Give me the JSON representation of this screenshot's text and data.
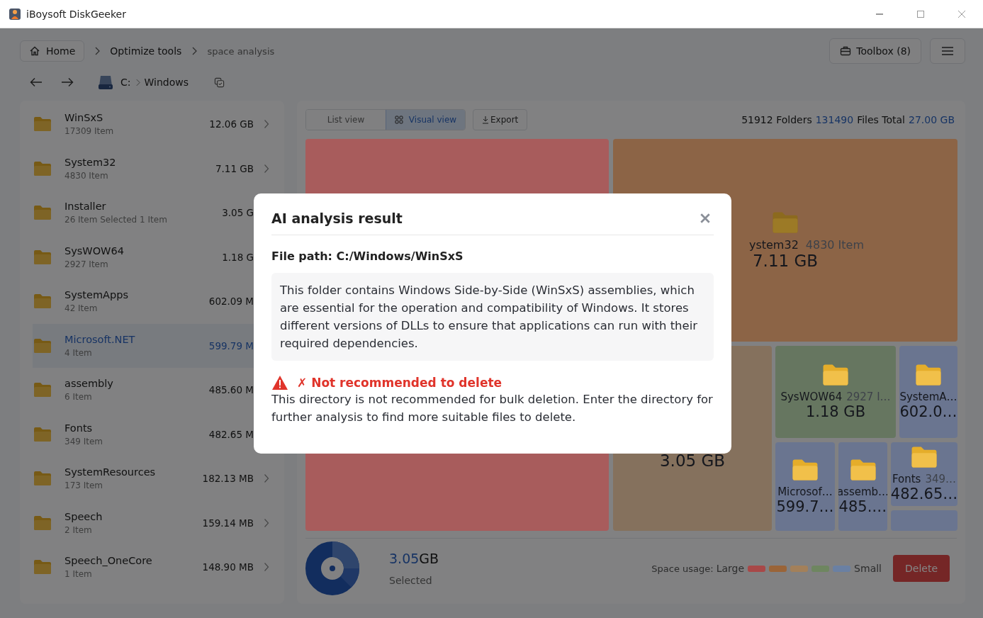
{
  "window": {
    "title": "iBoysoft DiskGeeker"
  },
  "breadcrumb": {
    "home": "Home",
    "items": [
      {
        "label": "Optimize tools",
        "current": false
      },
      {
        "label": "space analysis",
        "current": true
      }
    ]
  },
  "toolbox": {
    "label": "Toolbox",
    "count": "(8)"
  },
  "path": {
    "drive": "C:",
    "folder": "Windows"
  },
  "sidebar": {
    "items": [
      {
        "name": "WinSxS",
        "count": "17309 Item",
        "size": "12.06 GB",
        "selected": false,
        "chevron": true
      },
      {
        "name": "System32",
        "count": "4830 Item",
        "size": "7.11 GB",
        "selected": false,
        "chevron": true
      },
      {
        "name": "Installer",
        "count": "26 Item Selected 1 Item",
        "size": "3.05 G",
        "selected": false
      },
      {
        "name": "SysWOW64",
        "count": "2927 Item",
        "size": "1.18 G",
        "selected": false
      },
      {
        "name": "SystemApps",
        "count": "42 Item",
        "size": "602.09 M",
        "selected": false
      },
      {
        "name": "Microsoft.NET",
        "count": "4 Item",
        "size": "599.79 M",
        "selected": true
      },
      {
        "name": "assembly",
        "count": "6 Item",
        "size": "485.60 M",
        "selected": false
      },
      {
        "name": "Fonts",
        "count": "349 Item",
        "size": "482.65 M",
        "selected": false
      },
      {
        "name": "SystemResources",
        "count": "173 Item",
        "size": "182.13 MB",
        "selected": false,
        "chevron": true
      },
      {
        "name": "Speech",
        "count": "2 Item",
        "size": "159.14 MB",
        "selected": false,
        "chevron": true
      },
      {
        "name": "Speech_OneCore",
        "count": "1 Item",
        "size": "148.90 MB",
        "selected": false,
        "chevron": true
      }
    ]
  },
  "view_tabs": [
    {
      "label": "List view",
      "selected": false
    },
    {
      "label": "Visual view",
      "selected": true
    }
  ],
  "export": "Export",
  "stats": {
    "folders": "51912",
    "folders_label": "Folders",
    "files": "131490",
    "files_label": "Files Total",
    "total": "27.00 GB"
  },
  "tiles": [
    {
      "color": "#a85c5c"
    },
    {
      "color": "#8c6446"
    },
    {
      "color": "#85715d",
      "size": "3.05 GB"
    },
    {
      "color": "#667660",
      "name": "SysWOW64",
      "count": "2927 I…",
      "size": "1.18 GB"
    },
    {
      "color": "#6a7590",
      "name": "SystemA…",
      "size": "602.0…"
    },
    {
      "color": "#6a7590",
      "name": "Microsof…",
      "size": "599.7…"
    },
    {
      "color": "#6a7590",
      "name": "assemb…",
      "size": "485.…"
    },
    {
      "color": "#6a7590",
      "name": "Fonts",
      "count": "349…",
      "size": "482.65…"
    },
    {
      "color": "#6a7590"
    }
  ],
  "tile_label": {
    "name": "ystem32",
    "count": "4830 Item",
    "size": "7.11 GB"
  },
  "selection": {
    "value": "3.05",
    "unit": "GB",
    "label": "Selected"
  },
  "legend": {
    "label": "Space usage:",
    "large": "Large",
    "small": "Small",
    "swatches": [
      {
        "color": "#a84848"
      },
      {
        "color": "#9a6438"
      },
      {
        "color": "#a3805a"
      },
      {
        "color": "#6e8660"
      },
      {
        "color": "#6a80a3"
      }
    ]
  },
  "delete": "Delete",
  "dialog": {
    "title": "AI analysis result",
    "path": "File path: C:/Windows/WinSxS",
    "description": "This folder contains Windows Side-by-Side (WinSxS) assemblies, which are essential for the operation and compatibility of Windows. It stores different versions of DLLs to ensure that applications can run with their required dependencies.",
    "verdict": "✗ Not recommended to delete",
    "recommended": false,
    "advice": "This directory is not recommended for bulk deletion. Enter the directory for further analysis to find more suitable files to delete."
  }
}
